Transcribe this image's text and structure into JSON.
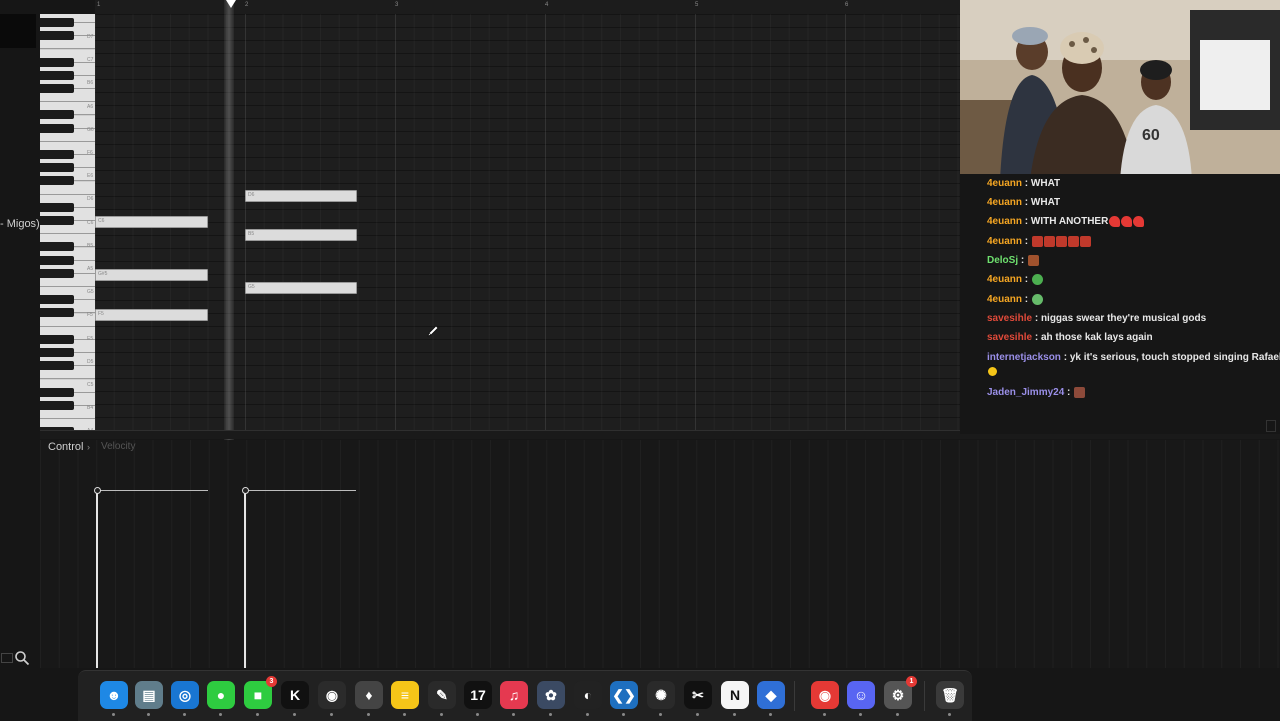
{
  "sidebar": {
    "track_name": "- Migos)"
  },
  "timeline": {
    "ticks": [
      "1",
      "2",
      "3",
      "4",
      "5",
      "6"
    ]
  },
  "piano": {
    "labels": [
      "D7",
      "C7",
      "B6",
      "A6",
      "G6",
      "F6",
      "E6",
      "D6",
      "C6",
      "B5",
      "A5",
      "G5",
      "F5",
      "E5",
      "D5",
      "C5",
      "B4",
      "A4"
    ]
  },
  "notes": [
    {
      "label": "C6"
    },
    {
      "label": "G#5"
    },
    {
      "label": "F5"
    },
    {
      "label": "D6"
    },
    {
      "label": "B5"
    },
    {
      "label": "G5"
    }
  ],
  "control": {
    "label": "Control",
    "arrow": "›",
    "param": "Velocity"
  },
  "chat": {
    "messages": [
      {
        "user": "4euann",
        "text": "WHAT",
        "color": "#f5a623"
      },
      {
        "user": "4euann",
        "text": "WHAT",
        "color": "#f5a623"
      },
      {
        "user": "4euann",
        "text": "WITH ANOTHER",
        "color": "#f5a623",
        "emotes": [
          "heart",
          "heart",
          "heart"
        ]
      },
      {
        "user": "4euann",
        "text": "",
        "color": "#f5a623",
        "emotes": [
          "rose",
          "rose",
          "rose",
          "rose",
          "rose"
        ]
      },
      {
        "user": "DeloSj",
        "text": "",
        "color": "#6ee06e",
        "emotes": [
          "face"
        ]
      },
      {
        "user": "4euann",
        "text": "",
        "color": "#f5a623",
        "emotes": [
          "green"
        ]
      },
      {
        "user": "4euann",
        "text": "",
        "color": "#f5a623",
        "emotes": [
          "green-face"
        ]
      },
      {
        "user": "savesihle",
        "text": "niggas swear they're musical gods",
        "color": "#e04a3a"
      },
      {
        "user": "savesihle",
        "text": "ah those kak lays again",
        "color": "#e04a3a"
      },
      {
        "user": "internetjackson",
        "text": "yk it's serious, touch stopped singing Rafael",
        "color": "#9a8fe8",
        "emotes": [
          "laugh"
        ]
      },
      {
        "user": "Jaden_Jimmy24",
        "text": "",
        "color": "#9a8fe8",
        "emotes": [
          "face2"
        ]
      }
    ]
  },
  "dock": {
    "icons": [
      {
        "name": "finder-icon",
        "color": "#1e88e5",
        "glyph": "☻"
      },
      {
        "name": "files-icon",
        "color": "#607d8b",
        "glyph": "▤"
      },
      {
        "name": "safari-icon",
        "color": "#1976d2",
        "glyph": "◎"
      },
      {
        "name": "messages-icon",
        "color": "#2ecc40",
        "glyph": "●"
      },
      {
        "name": "facetime-icon",
        "color": "#2ecc40",
        "glyph": "■",
        "badge": "3"
      },
      {
        "name": "kick-icon",
        "color": "#111111",
        "glyph": "K"
      },
      {
        "name": "obs-icon",
        "color": "#2b2b2b",
        "glyph": "◉"
      },
      {
        "name": "fl-studio-icon",
        "color": "#444444",
        "glyph": "♦"
      },
      {
        "name": "notes-icon",
        "color": "#f5c518",
        "glyph": "≡"
      },
      {
        "name": "pen-icon",
        "color": "#2a2a2a",
        "glyph": "✎"
      },
      {
        "name": "tradingview-icon",
        "color": "#111111",
        "glyph": "17"
      },
      {
        "name": "music-icon",
        "color": "#e53950",
        "glyph": "♫"
      },
      {
        "name": "davinci-icon",
        "color": "#3b4a63",
        "glyph": "✿"
      },
      {
        "name": "github-icon",
        "color": "#222222",
        "glyph": "◐"
      },
      {
        "name": "vscode-icon",
        "color": "#1e6fbf",
        "glyph": "❮❯"
      },
      {
        "name": "chatgpt-icon",
        "color": "#2a2a2a",
        "glyph": "✺"
      },
      {
        "name": "capcut-icon",
        "color": "#111111",
        "glyph": "✂"
      },
      {
        "name": "notion-icon",
        "color": "#f5f5f5",
        "glyph": "N"
      },
      {
        "name": "roblox-icon",
        "color": "#2f6fd6",
        "glyph": "◆"
      },
      {
        "name": "chrome-icon",
        "color": "#e53935",
        "glyph": "◉"
      },
      {
        "name": "discord-icon",
        "color": "#5865f2",
        "glyph": "☺"
      },
      {
        "name": "settings-icon",
        "color": "#555555",
        "glyph": "⚙",
        "badge": "1"
      },
      {
        "name": "trash-icon",
        "color": "#3a3a3a",
        "glyph": "🗑"
      }
    ]
  }
}
